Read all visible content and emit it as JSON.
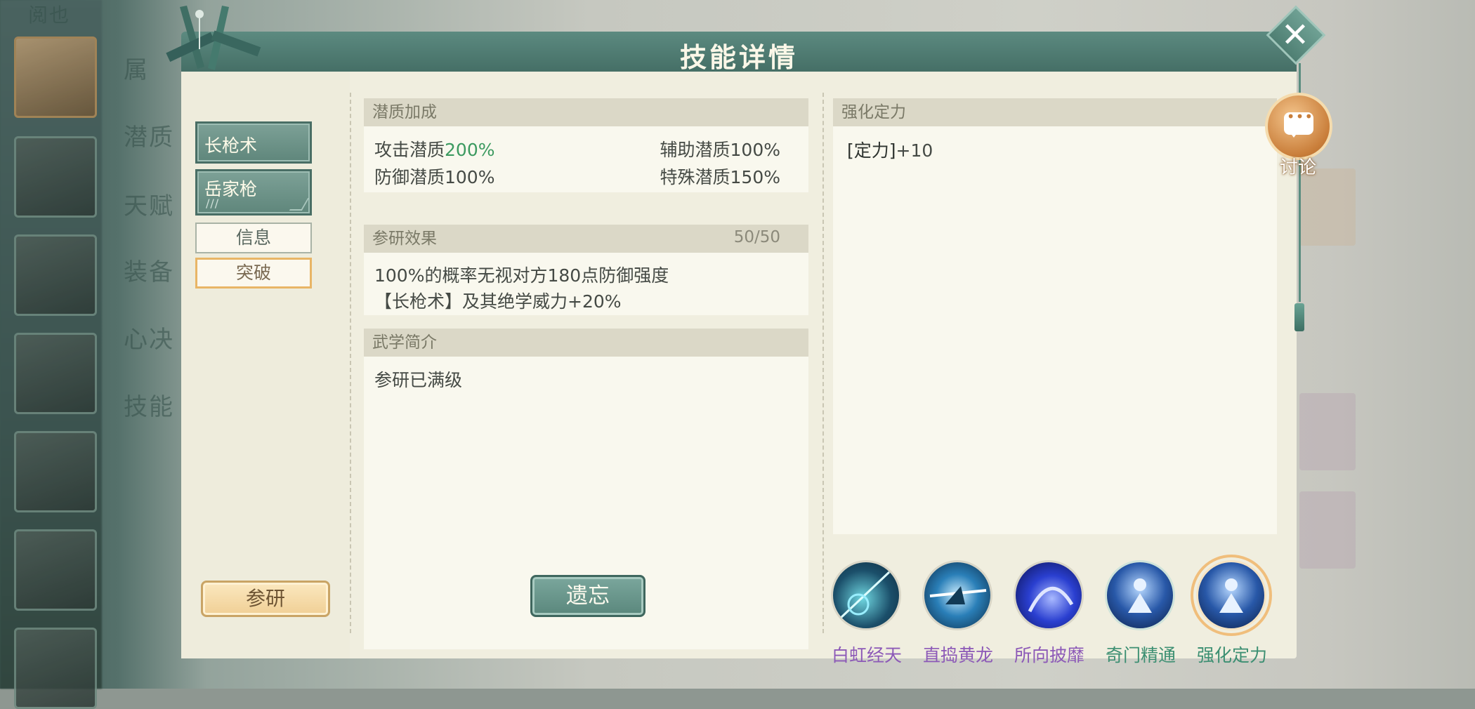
{
  "background": {
    "side_labels": [
      "属",
      "潜质",
      "天赋",
      "装备",
      "心决",
      "技能"
    ],
    "top_left_label": "阅也"
  },
  "dialog": {
    "title": "技能详情",
    "skill_tabs": [
      {
        "label": "长枪术",
        "marks": ""
      },
      {
        "label": "岳家枪",
        "marks": "///"
      }
    ],
    "sub_tabs": [
      {
        "label": "信息",
        "active": false
      },
      {
        "label": "突破",
        "active": true
      }
    ],
    "research_button": "参研",
    "forget_button": "遗忘",
    "potential": {
      "header": "潜质加成",
      "attack_label": "攻击潜质",
      "attack_value": "200%",
      "assist": "辅助潜质100%",
      "defense": "防御潜质100%",
      "special": "特殊潜质150%"
    },
    "research": {
      "header": "参研效果",
      "progress": "50/50",
      "line1": "100%的概率无视对方180点防御强度",
      "line2": "【长枪术】及其绝学威力+20%"
    },
    "intro": {
      "header": "武学简介",
      "text": "参研已满级"
    },
    "enhance": {
      "header": "强化定力",
      "tag": "[定力]",
      "value": "+10"
    },
    "skill_icons": [
      {
        "name": "白虹经天",
        "icon": "spear-thrust-icon",
        "label_color": "#8c59b7"
      },
      {
        "name": "直捣黄龙",
        "icon": "charge-icon",
        "label_color": "#8c59b7"
      },
      {
        "name": "所向披靡",
        "icon": "sweep-icon",
        "label_color": "#8c59b7"
      },
      {
        "name": "奇门精通",
        "icon": "meditate-icon",
        "label_color": "#3c8f72"
      },
      {
        "name": "强化定力",
        "icon": "meditate-icon",
        "label_color": "#3c8f72",
        "selected": true
      }
    ]
  },
  "close_button": "✕",
  "discussion": {
    "label": "讨论",
    "icon": "chat-icon"
  },
  "colors": {
    "header": "#4f7d73",
    "panel": "#f0eedf",
    "accent_gold": "#e8b566",
    "green_value": "#3c9a60"
  }
}
